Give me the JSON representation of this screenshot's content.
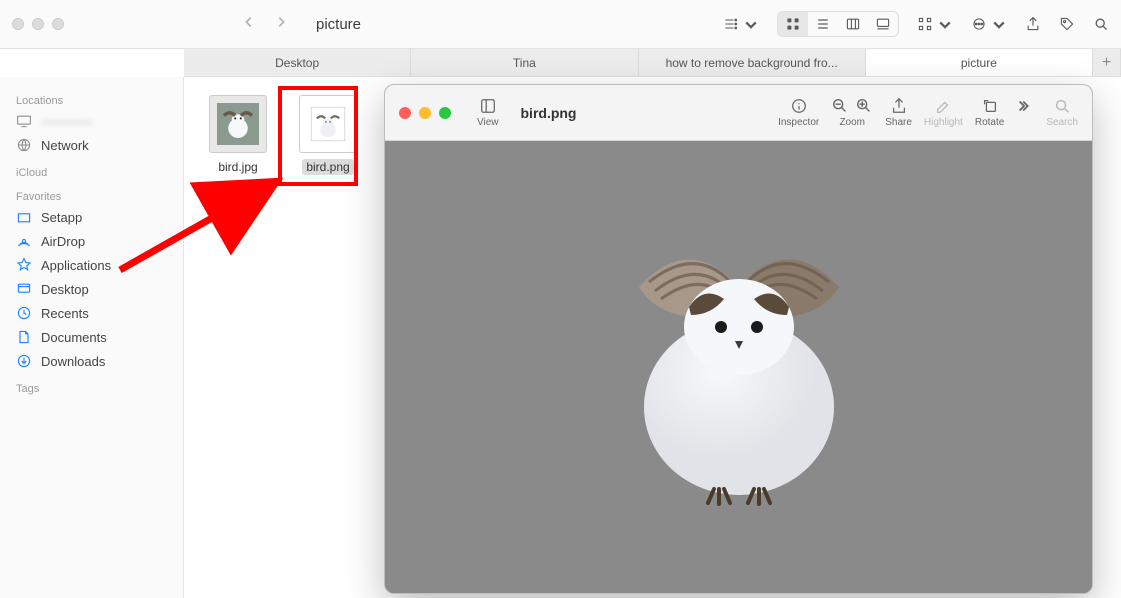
{
  "window": {
    "title": "picture"
  },
  "tabs": [
    {
      "label": "Desktop",
      "active": false
    },
    {
      "label": "Tina",
      "active": false
    },
    {
      "label": "how to remove background fro...",
      "active": false
    },
    {
      "label": "picture",
      "active": true
    }
  ],
  "sidebar": {
    "sections": {
      "locations": "Locations",
      "icloud": "iCloud",
      "favorites": "Favorites",
      "tags": "Tags"
    },
    "items": {
      "network": "Network",
      "setapp": "Setapp",
      "airdrop": "AirDrop",
      "applications": "Applications",
      "desktop": "Desktop",
      "recents": "Recents",
      "documents": "Documents",
      "downloads": "Downloads"
    }
  },
  "files": [
    {
      "name": "bird.jpg",
      "selected": false
    },
    {
      "name": "bird.png",
      "selected": true
    }
  ],
  "preview": {
    "title": "bird.png",
    "tools": {
      "view": "View",
      "inspector": "Inspector",
      "zoom": "Zoom",
      "share": "Share",
      "highlight": "Highlight",
      "rotate": "Rotate",
      "search": "Search"
    }
  }
}
